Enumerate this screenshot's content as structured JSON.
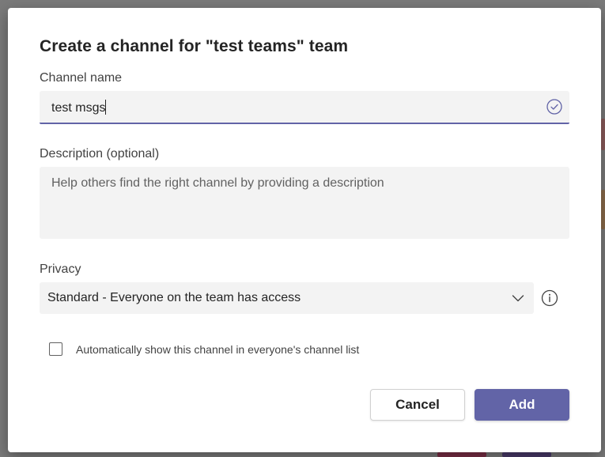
{
  "dialog": {
    "title": "Create a channel for \"test teams\" team"
  },
  "channel_name": {
    "label": "Channel name",
    "value": "test msgs",
    "status_icon": "check-circle-icon"
  },
  "description": {
    "label": "Description (optional)",
    "placeholder": "Help others find the right channel by providing a description",
    "value": ""
  },
  "privacy": {
    "label": "Privacy",
    "selected": "Standard - Everyone on the team has access",
    "dropdown_icon": "chevron-down-icon",
    "info_icon": "info-icon"
  },
  "auto_show": {
    "label": "Automatically show this channel in everyone's channel list",
    "checked": false
  },
  "buttons": {
    "cancel_label": "Cancel",
    "add_label": "Add"
  },
  "colors": {
    "accent": "#6264a7",
    "field_bg": "#f3f3f3",
    "backdrop": "#7a7a7a"
  }
}
